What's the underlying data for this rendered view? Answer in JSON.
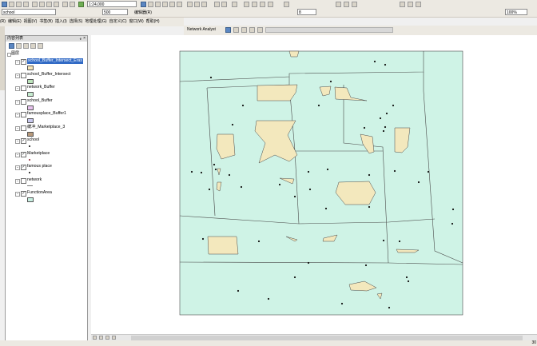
{
  "toolbar": {
    "layer_select": "school",
    "scale": "1:24,000",
    "zoom": "500",
    "editor_label": "编辑器(R)",
    "page_num": "8",
    "zoom_pct": "100%"
  },
  "menu": [
    "(R)",
    "编辑(E)",
    "视图(V)",
    "书签(B)",
    "插入(I)",
    "选择(S)",
    "地理处理(G)",
    "自定义(C)",
    "窗口(W)",
    "帮助(H)"
  ],
  "network_analyst_label": "Network Analyst",
  "toc": {
    "title": "内容列表",
    "pin": "ᵩ",
    "close": "×",
    "root_label": "图层",
    "layers": [
      {
        "label": "school_Buffer_Intersect_Eras",
        "checked": true,
        "symbol": "poly",
        "color": "#f5e4b8",
        "selected": true
      },
      {
        "label": "school_Buffer_Intersect",
        "checked": false,
        "symbol": "poly",
        "color": "#bde4bc"
      },
      {
        "label": "network_Buffer",
        "checked": false,
        "symbol": "poly",
        "color": "#c6ecd0"
      },
      {
        "label": "school_Buffer",
        "checked": false,
        "symbol": "poly",
        "color": "#e9c3ef"
      },
      {
        "label": "famousplace_Buffer1",
        "checked": false,
        "symbol": "poly",
        "color": "#c8c8ee"
      },
      {
        "label": "缓冲_Marketplace_3",
        "checked": false,
        "symbol": "poly",
        "color": "#b89a7c"
      },
      {
        "label": "school",
        "checked": true,
        "symbol": "dot",
        "color": "#000000"
      },
      {
        "label": "Marketplace",
        "checked": true,
        "symbol": "dot",
        "color": "#8a1a2a"
      },
      {
        "label": "famous place",
        "checked": true,
        "symbol": "dot",
        "color": "#000000"
      },
      {
        "label": "network",
        "checked": false,
        "symbol": "line",
        "color": "#777777"
      },
      {
        "label": "FunctionArea",
        "checked": true,
        "symbol": "poly",
        "color": "#c8f0e2"
      }
    ]
  },
  "map": {
    "area_color": "#cff3e6",
    "buffer_color": "#f3e8bd",
    "boundary_color": "#4a4a4a"
  },
  "status": {
    "coords": "30"
  }
}
